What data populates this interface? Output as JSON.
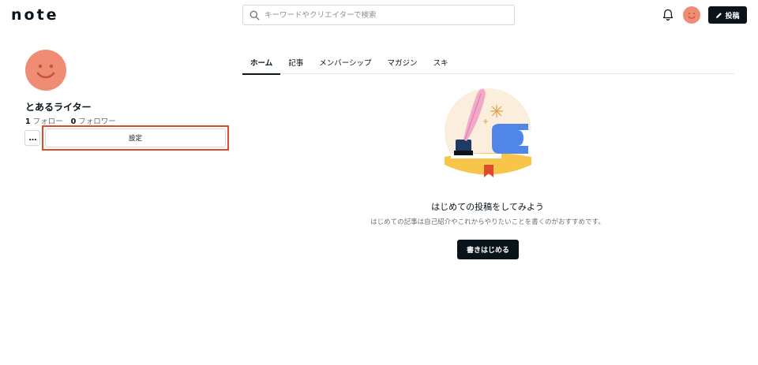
{
  "header": {
    "logo": "note",
    "search_placeholder": "キーワードやクリエイターで検索",
    "post_label": "投稿"
  },
  "profile": {
    "name": "とあるライター",
    "follow_count": "1",
    "follow_label": "フォロー",
    "follower_count": "0",
    "follower_label": "フォロワー",
    "more_label": "…",
    "settings_label": "設定"
  },
  "tabs": [
    {
      "label": "ホーム",
      "active": true
    },
    {
      "label": "記事",
      "active": false
    },
    {
      "label": "メンバーシップ",
      "active": false
    },
    {
      "label": "マガジン",
      "active": false
    },
    {
      "label": "スキ",
      "active": false
    }
  ],
  "empty_state": {
    "title": "はじめての投稿をしてみよう",
    "subtitle": "はじめての記事は自己紹介やこれからやりたいことを書くのがおすすめです。",
    "button_label": "書きはじめる"
  },
  "colors": {
    "accent": "#08131a",
    "avatar": "#f08c73",
    "highlight": "#e0492b"
  },
  "icons": [
    "search-icon",
    "bell-icon",
    "pencil-icon",
    "smile-face-icon"
  ]
}
